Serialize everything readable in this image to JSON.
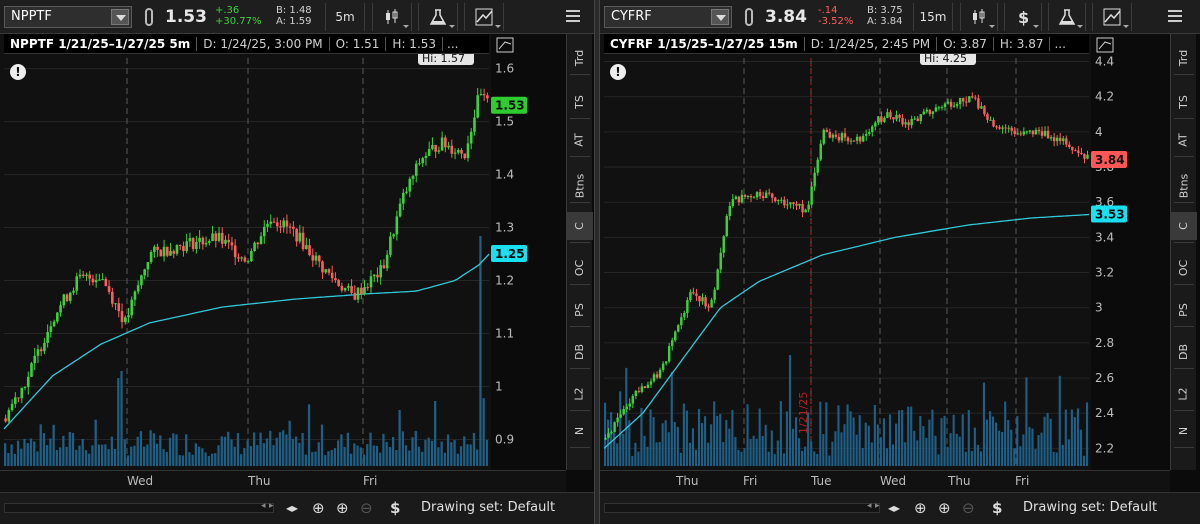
{
  "left": {
    "symbol": "NPPTF",
    "last": "1.53",
    "change_abs": "+.36",
    "change_pct": "+30.77%",
    "bid": "B: 1.48",
    "ask": "A: 1.59",
    "interval": "5m",
    "header": {
      "title": "NPPTF 1/21/25–1/27/25 5m",
      "date": "D: 1/24/25, 3:00 PM",
      "open": "O: 1.51",
      "high": "H: 1.53",
      "more": "..."
    },
    "high_marker": "Hi: 1.57",
    "price_badge": "1.53",
    "ma_badge": "1.25",
    "y_ticks": [
      "1.6",
      "1.5",
      "1.4",
      "1.3",
      "1.2",
      "1.1",
      "1",
      "0.9"
    ],
    "x_labels": [
      "Wed",
      "Thu",
      "Fri"
    ],
    "side_tabs": [
      "Trd",
      "TS",
      "AT",
      "Btns",
      "C",
      "OC",
      "PS",
      "DB",
      "L2",
      "N"
    ],
    "drawing_set": "Drawing set: Default"
  },
  "right": {
    "symbol": "CYFRF",
    "last": "3.84",
    "change_abs": "-.14",
    "change_pct": "-3.52%",
    "bid": "B: 3.75",
    "ask": "A: 3.84",
    "interval": "15m",
    "header": {
      "title": "CYFRF 1/15/25–1/27/25 15m",
      "date": "D: 1/24/25, 2:45 PM",
      "open": "O: 3.87",
      "high": "H: 3.87",
      "more": "..."
    },
    "high_marker": "Hi: 4.25",
    "date_marker": "1/21/25",
    "price_badge": "3.84",
    "ma_badge": "3.53",
    "y_ticks": [
      "4.4",
      "4.2",
      "4",
      "3.8",
      "3.6",
      "3.4",
      "3.2",
      "3",
      "2.8",
      "2.6",
      "2.4",
      "2.2"
    ],
    "x_labels": [
      "Thu",
      "Fri",
      "Tue",
      "Wed",
      "Thu",
      "Fri"
    ],
    "side_tabs": [
      "Trd",
      "TS",
      "AT",
      "Btns",
      "C",
      "OC",
      "PS",
      "DB",
      "L2",
      "N"
    ],
    "drawing_set": "Drawing set: Default"
  },
  "colors": {
    "up": "#3ed13e",
    "down": "#ff5e5e",
    "ma": "#32c8d8",
    "volume": "#1f5f86",
    "badge_up": "#2fcc2f",
    "badge_down": "#ff5656",
    "badge_ma": "#19dff1"
  },
  "chart_data": [
    {
      "type": "candlestick",
      "title": "NPPTF 1/21/25–1/27/25 5m",
      "ylim": [
        0.85,
        1.62
      ],
      "x_labels": [
        "Wed",
        "Thu",
        "Fri"
      ],
      "series": [
        {
          "name": "price",
          "anchors": [
            [
              0,
              0.94
            ],
            [
              0.05,
              1.02
            ],
            [
              0.1,
              1.13
            ],
            [
              0.15,
              1.2
            ],
            [
              0.2,
              1.21
            ],
            [
              0.25,
              1.12
            ],
            [
              0.3,
              1.25
            ],
            [
              0.38,
              1.27
            ],
            [
              0.44,
              1.28
            ],
            [
              0.5,
              1.24
            ],
            [
              0.55,
              1.32
            ],
            [
              0.6,
              1.29
            ],
            [
              0.66,
              1.22
            ],
            [
              0.72,
              1.17
            ],
            [
              0.78,
              1.22
            ],
            [
              0.82,
              1.35
            ],
            [
              0.86,
              1.43
            ],
            [
              0.9,
              1.46
            ],
            [
              0.95,
              1.44
            ],
            [
              0.98,
              1.55
            ],
            [
              1,
              1.53
            ]
          ]
        },
        {
          "name": "moving average",
          "anchors": [
            [
              0,
              0.92
            ],
            [
              0.1,
              1.02
            ],
            [
              0.2,
              1.08
            ],
            [
              0.3,
              1.12
            ],
            [
              0.45,
              1.15
            ],
            [
              0.6,
              1.165
            ],
            [
              0.75,
              1.175
            ],
            [
              0.85,
              1.18
            ],
            [
              0.93,
              1.2
            ],
            [
              0.98,
              1.23
            ],
            [
              1,
              1.25
            ]
          ]
        }
      ]
    },
    {
      "type": "candlestick",
      "title": "CYFRF 1/15/25–1/27/25 15m",
      "ylim": [
        2.1,
        4.42
      ],
      "x_labels": [
        "Thu",
        "Fri",
        "Tue",
        "Wed",
        "Thu",
        "Fri"
      ],
      "series": [
        {
          "name": "price",
          "anchors": [
            [
              0,
              2.25
            ],
            [
              0.06,
              2.5
            ],
            [
              0.12,
              2.65
            ],
            [
              0.18,
              3.1
            ],
            [
              0.22,
              3.0
            ],
            [
              0.26,
              3.6
            ],
            [
              0.32,
              3.65
            ],
            [
              0.38,
              3.6
            ],
            [
              0.42,
              3.55
            ],
            [
              0.45,
              4.0
            ],
            [
              0.52,
              3.95
            ],
            [
              0.58,
              4.1
            ],
            [
              0.63,
              4.05
            ],
            [
              0.7,
              4.15
            ],
            [
              0.76,
              4.2
            ],
            [
              0.8,
              4.05
            ],
            [
              0.86,
              3.98
            ],
            [
              0.9,
              4.0
            ],
            [
              0.95,
              3.95
            ],
            [
              1,
              3.84
            ]
          ]
        },
        {
          "name": "moving average",
          "anchors": [
            [
              0,
              2.2
            ],
            [
              0.08,
              2.4
            ],
            [
              0.16,
              2.7
            ],
            [
              0.24,
              3.0
            ],
            [
              0.32,
              3.15
            ],
            [
              0.45,
              3.3
            ],
            [
              0.6,
              3.4
            ],
            [
              0.75,
              3.47
            ],
            [
              0.88,
              3.51
            ],
            [
              1,
              3.53
            ]
          ]
        }
      ]
    }
  ]
}
